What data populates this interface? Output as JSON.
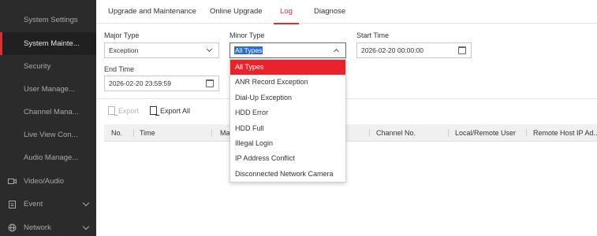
{
  "sidebar": {
    "items": [
      {
        "label": "System Settings"
      },
      {
        "label": "System Mainte..."
      },
      {
        "label": "Security"
      },
      {
        "label": "User Manage..."
      },
      {
        "label": "Channel Mana..."
      },
      {
        "label": "Live View Con..."
      },
      {
        "label": "Audio Manage..."
      },
      {
        "label": "Video/Audio"
      },
      {
        "label": "Event"
      },
      {
        "label": "Network"
      }
    ]
  },
  "tabs": [
    "Upgrade and Maintenance",
    "Online Upgrade",
    "Log",
    "Diagnose"
  ],
  "filters": {
    "major_type_label": "Major Type",
    "major_type_value": "Exception",
    "minor_type_label": "Minor Type",
    "minor_type_value": "All Types",
    "start_time_label": "Start Time",
    "start_time_value": "2026-02-20 00:00:00",
    "end_time_label": "End Time",
    "end_time_value": "2026-02-20 23:59:59"
  },
  "actions": {
    "export": "Export",
    "export_all": "Export All"
  },
  "table": {
    "columns": [
      "No.",
      "Time",
      "Maj",
      "Channel No.",
      "Local/Remote User",
      "Remote Host IP Ad..."
    ]
  },
  "dropdown": {
    "options": [
      "All Types",
      "ANR Record Exception",
      "Dial-Up Exception",
      "HDD Error",
      "HDD Full",
      "Illegal Login",
      "IP Address Conflict",
      "Disconnected Network Camera"
    ],
    "selected": "All Types"
  },
  "colors": {
    "accent": "#e02c2c",
    "sidebar_bg": "#2b2b2b",
    "selection": "#2a6fdb"
  }
}
